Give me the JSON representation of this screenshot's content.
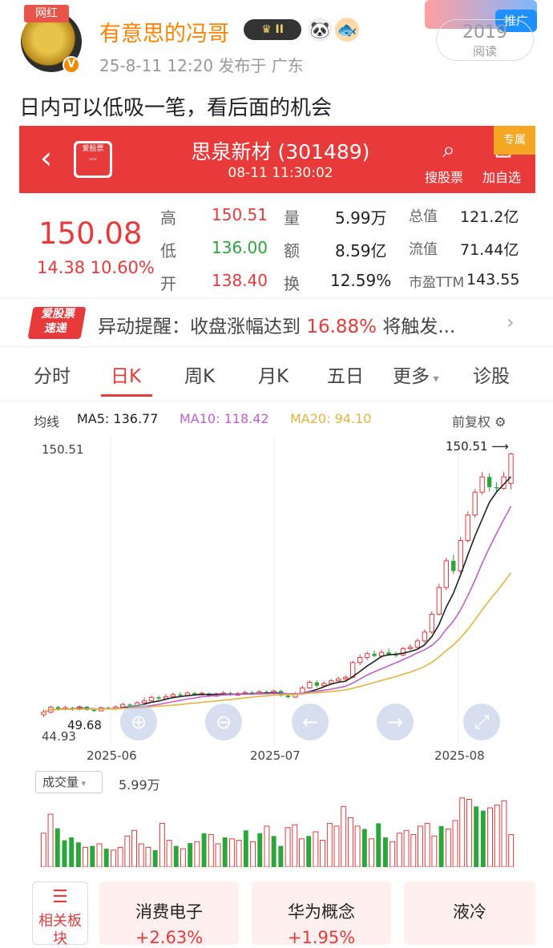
{
  "post": {
    "badge": "网红",
    "username": "有意思的冯哥",
    "level": "II",
    "meta": "25-8-11 12:20  发布于 广东",
    "ad_label": "推广",
    "read_count": "2019",
    "read_label": "阅读",
    "text": "日内可以低吸一笔，看后面的机会"
  },
  "stock": {
    "app_logo": "爱股票",
    "name": "思泉新材 (301489)",
    "time": "08-11 11:30:02",
    "search_label": "搜股票",
    "add_label": "加自选",
    "ribbon": "专属",
    "price": "150.08",
    "change": "14.38 10.60%",
    "quote": [
      {
        "l1": "高",
        "v1": "150.51",
        "l2": "量",
        "v2": "5.99万",
        "l3": "总值",
        "v3": "121.2亿"
      },
      {
        "l1": "低",
        "v1": "136.00",
        "l2": "额",
        "v2": "8.59亿",
        "l3": "流值",
        "v3": "71.44亿"
      },
      {
        "l1": "开",
        "v1": "138.40",
        "l2": "换",
        "v2": "12.59%",
        "l3": "市盈TTM",
        "v3": "143.55"
      }
    ]
  },
  "alert": {
    "logo_top": "爱股票",
    "logo_bottom": "速递",
    "prefix": "异动提醒：收盘涨幅达到 ",
    "highlight": "16.88%",
    "suffix": " 将触发..."
  },
  "tabs": [
    "分时",
    "日K",
    "周K",
    "月K",
    "五日",
    "更多",
    "诊股"
  ],
  "ma": {
    "label": "均线",
    "ma5": "MA5: 136.77",
    "ma10": "MA10: 118.42",
    "ma20": "MA20: 94.10",
    "adjust": "前复权",
    "colors": {
      "ma5": "#222222",
      "ma10": "#c060d0",
      "ma20": "#e6b43a",
      "up": "#e8393b",
      "down": "#2aa63a"
    }
  },
  "chart_data": {
    "type": "candlestick",
    "high_label": "150.51",
    "max_label": "150.51",
    "low_label": "44.93",
    "low_marker": "49.68",
    "dates": [
      "2025-06",
      "2025-07",
      "2025-08"
    ],
    "ylim": [
      44.93,
      150.51
    ],
    "candles": [
      [
        47.5,
        48.5,
        49.5,
        46.5
      ],
      [
        48.5,
        50.5,
        51.0,
        48.0
      ],
      [
        50.5,
        49.8,
        51.0,
        49.0
      ],
      [
        49.8,
        50.2,
        51.0,
        49.3
      ],
      [
        50.2,
        49.6,
        50.6,
        49.0
      ],
      [
        49.6,
        50.6,
        51.1,
        49.2
      ],
      [
        50.6,
        49.4,
        51.0,
        49.0
      ],
      [
        49.4,
        49.0,
        50.0,
        48.6
      ],
      [
        49.0,
        50.2,
        50.6,
        48.8
      ],
      [
        50.2,
        49.9,
        50.8,
        49.4
      ],
      [
        49.9,
        50.5,
        51.2,
        49.5
      ],
      [
        50.5,
        51.5,
        52.2,
        50.2
      ],
      [
        51.5,
        51.0,
        52.0,
        50.4
      ],
      [
        51.0,
        52.2,
        52.8,
        50.8
      ],
      [
        52.2,
        53.0,
        54.2,
        51.9
      ],
      [
        53.0,
        54.3,
        55.0,
        52.8
      ],
      [
        54.3,
        53.8,
        55.0,
        53.2
      ],
      [
        53.8,
        54.6,
        55.6,
        53.5
      ],
      [
        54.6,
        55.4,
        56.2,
        54.4
      ],
      [
        55.4,
        55.0,
        56.4,
        54.6
      ],
      [
        55.0,
        56.0,
        56.8,
        54.8
      ],
      [
        56.0,
        55.3,
        56.5,
        54.9
      ],
      [
        55.3,
        55.9,
        56.6,
        55.0
      ],
      [
        55.9,
        54.8,
        56.2,
        54.4
      ],
      [
        54.8,
        55.6,
        56.3,
        54.5
      ],
      [
        55.6,
        56.0,
        56.8,
        55.2
      ],
      [
        56.0,
        55.2,
        56.6,
        54.8
      ],
      [
        55.2,
        55.8,
        56.5,
        54.9
      ],
      [
        55.8,
        56.2,
        57.0,
        55.5
      ],
      [
        56.2,
        55.6,
        56.8,
        55.1
      ],
      [
        55.6,
        56.5,
        57.2,
        55.4
      ],
      [
        56.5,
        55.9,
        57.0,
        55.4
      ],
      [
        55.9,
        56.8,
        57.4,
        55.5
      ],
      [
        56.8,
        55.0,
        57.2,
        54.6
      ],
      [
        55.0,
        54.4,
        55.6,
        53.9
      ],
      [
        54.4,
        55.6,
        56.4,
        54.1
      ],
      [
        55.6,
        58.0,
        59.0,
        55.4
      ],
      [
        58.0,
        60.2,
        61.0,
        57.8
      ],
      [
        60.2,
        58.9,
        61.0,
        58.2
      ],
      [
        58.9,
        59.8,
        60.6,
        58.4
      ],
      [
        59.8,
        60.8,
        61.6,
        59.2
      ],
      [
        60.8,
        61.6,
        62.4,
        60.3
      ],
      [
        61.6,
        62.2,
        63.0,
        61.0
      ],
      [
        62.2,
        68.0,
        68.8,
        61.8
      ],
      [
        68.0,
        70.0,
        71.2,
        67.0
      ],
      [
        70.0,
        71.5,
        72.4,
        69.0
      ],
      [
        71.5,
        70.6,
        72.8,
        70.0
      ],
      [
        70.6,
        72.0,
        73.0,
        69.8
      ],
      [
        72.0,
        71.2,
        73.5,
        70.6
      ],
      [
        71.2,
        71.0,
        72.4,
        70.0
      ],
      [
        71.0,
        73.5,
        74.2,
        70.4
      ],
      [
        73.5,
        74.0,
        75.2,
        72.8
      ],
      [
        74.0,
        76.5,
        77.4,
        73.5
      ],
      [
        76.5,
        80.0,
        81.0,
        75.6
      ],
      [
        80.0,
        87.0,
        88.2,
        79.4
      ],
      [
        87.0,
        97.5,
        99.0,
        86.5
      ],
      [
        97.5,
        108.0,
        109.2,
        96.4
      ],
      [
        108.0,
        104.0,
        110.6,
        102.8
      ],
      [
        104.0,
        116.0,
        117.5,
        103.0
      ],
      [
        116.0,
        126.0,
        127.4,
        115.2
      ],
      [
        126.0,
        135.0,
        136.2,
        125.0
      ],
      [
        135.0,
        141.0,
        143.0,
        134.0
      ],
      [
        141.0,
        137.0,
        142.5,
        135.2
      ],
      [
        137.0,
        136.5,
        139.0,
        135.0
      ],
      [
        136.5,
        141.0,
        143.0,
        136.0
      ],
      [
        138.4,
        150.08,
        150.51,
        136.0
      ]
    ]
  },
  "controls": [
    "zoom-in",
    "zoom-out",
    "prev",
    "next",
    "fullscreen"
  ],
  "volume": {
    "selector": "成交量",
    "value": "5.99万",
    "bars": [
      0.48,
      0.75,
      0.55,
      0.38,
      0.42,
      0.35,
      0.28,
      0.3,
      0.33,
      0.26,
      0.24,
      0.28,
      0.44,
      0.52,
      0.33,
      0.28,
      0.24,
      0.62,
      0.38,
      0.3,
      0.26,
      0.34,
      0.36,
      0.48,
      0.46,
      0.33,
      0.42,
      0.4,
      0.38,
      0.52,
      0.36,
      0.48,
      0.58,
      0.44,
      0.3,
      0.56,
      0.6,
      0.4,
      0.44,
      0.5,
      0.38,
      0.62,
      0.58,
      0.86,
      0.7,
      0.58,
      0.54,
      0.4,
      0.62,
      0.42,
      0.36,
      0.48,
      0.52,
      0.46,
      0.58,
      0.62,
      0.44,
      0.58,
      0.54,
      0.66,
      0.98,
      0.96,
      0.86,
      0.8,
      0.84,
      0.88,
      0.94,
      0.46
    ],
    "up": [
      1,
      1,
      0,
      0,
      0,
      0,
      1,
      0,
      1,
      0,
      1,
      1,
      1,
      1,
      1,
      1,
      0,
      1,
      1,
      0,
      1,
      0,
      1,
      0,
      1,
      1,
      0,
      1,
      1,
      0,
      1,
      0,
      1,
      0,
      0,
      1,
      1,
      1,
      0,
      1,
      1,
      1,
      1,
      1,
      1,
      1,
      0,
      1,
      0,
      0,
      1,
      1,
      1,
      1,
      1,
      1,
      1,
      0,
      1,
      1,
      1,
      1,
      0,
      0,
      1,
      1,
      1,
      1
    ]
  },
  "related": {
    "label": "相关板块",
    "items": [
      {
        "name": "消费电子",
        "pct": "+2.63%"
      },
      {
        "name": "华为概念",
        "pct": "+1.95%"
      },
      {
        "name": "液冷",
        "pct": ""
      }
    ]
  }
}
